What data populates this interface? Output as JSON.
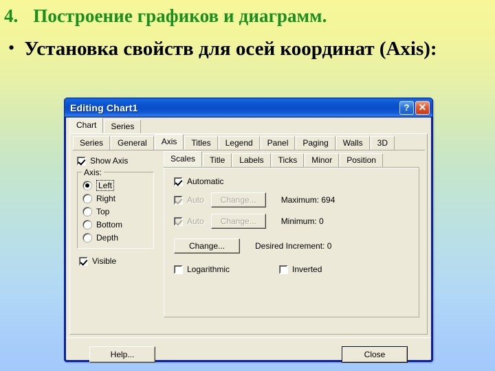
{
  "slide": {
    "heading_number": "4.",
    "heading_text": "Построение графиков и диаграмм.",
    "bullet_marker": "•",
    "bullet_text": "Установка свойств для осей координат (Axis):",
    "heading_color": "#1a8f1e",
    "bullet_color": "#000000",
    "background_top": "#f7f79a",
    "background_bottom": "#a3c9fb"
  },
  "dialog": {
    "title": "Editing Chart1",
    "titlebar_color": "#0a55d0",
    "help_button": "?",
    "close_button": "✕",
    "outer_tabs": [
      {
        "label": "Chart",
        "active": true
      },
      {
        "label": "Series",
        "active": false
      }
    ],
    "mid_tabs": [
      {
        "label": "Series",
        "active": false
      },
      {
        "label": "General",
        "active": false
      },
      {
        "label": "Axis",
        "active": true
      },
      {
        "label": "Titles",
        "active": false
      },
      {
        "label": "Legend",
        "active": false
      },
      {
        "label": "Panel",
        "active": false
      },
      {
        "label": "Paging",
        "active": false
      },
      {
        "label": "Walls",
        "active": false
      },
      {
        "label": "3D",
        "active": false
      }
    ],
    "inner_tabs": [
      {
        "label": "Scales",
        "active": true
      },
      {
        "label": "Title",
        "active": false
      },
      {
        "label": "Labels",
        "active": false
      },
      {
        "label": "Ticks",
        "active": false
      },
      {
        "label": "Minor",
        "active": false
      },
      {
        "label": "Position",
        "active": false
      }
    ],
    "left_panel": {
      "show_axis": {
        "label": "Show Axis",
        "checked": true
      },
      "axis_group_label": "Axis:",
      "axis_options": [
        {
          "label": "Left",
          "selected": true
        },
        {
          "label": "Right",
          "selected": false
        },
        {
          "label": "Top",
          "selected": false
        },
        {
          "label": "Bottom",
          "selected": false
        },
        {
          "label": "Depth",
          "selected": false
        }
      ],
      "visible": {
        "label": "Visible",
        "checked": true
      }
    },
    "scales_panel": {
      "automatic": {
        "label": "Automatic",
        "checked": true
      },
      "auto_max": {
        "label": "Auto",
        "checked": true,
        "enabled": false
      },
      "auto_min": {
        "label": "Auto",
        "checked": true,
        "enabled": false
      },
      "change_max_button": "Change...",
      "change_min_button": "Change...",
      "maximum_text": "Maximum:  694",
      "minimum_text": "Minimum:  0",
      "change_increment_button": "Change...",
      "increment_text": "Desired Increment:  0",
      "logarithmic": {
        "label": "Logarithmic",
        "checked": false
      },
      "inverted": {
        "label": "Inverted",
        "checked": false
      }
    },
    "footer": {
      "help_label": "Help...",
      "close_label": "Close"
    }
  }
}
